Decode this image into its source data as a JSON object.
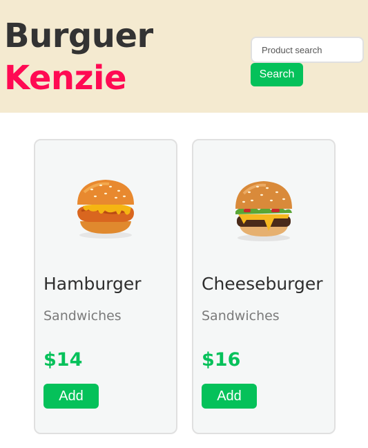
{
  "header": {
    "logo_line1": "Burguer",
    "logo_line2": "Kenzie",
    "search_placeholder": "Product search",
    "search_value": "",
    "search_button_label": "Search"
  },
  "colors": {
    "header_bg": "#f4ead0",
    "brand_dark": "#333333",
    "brand_accent": "#ff0a53",
    "primary_green": "#05c15a",
    "card_bg": "#f5f7f7"
  },
  "products": [
    {
      "image": "hamburger-image",
      "name": "Hamburger",
      "category": "Sandwiches",
      "price": "$14",
      "add_label": "Add"
    },
    {
      "image": "cheeseburger-image",
      "name": "Cheeseburger",
      "category": "Sandwiches",
      "price": "$16",
      "add_label": "Add"
    }
  ]
}
